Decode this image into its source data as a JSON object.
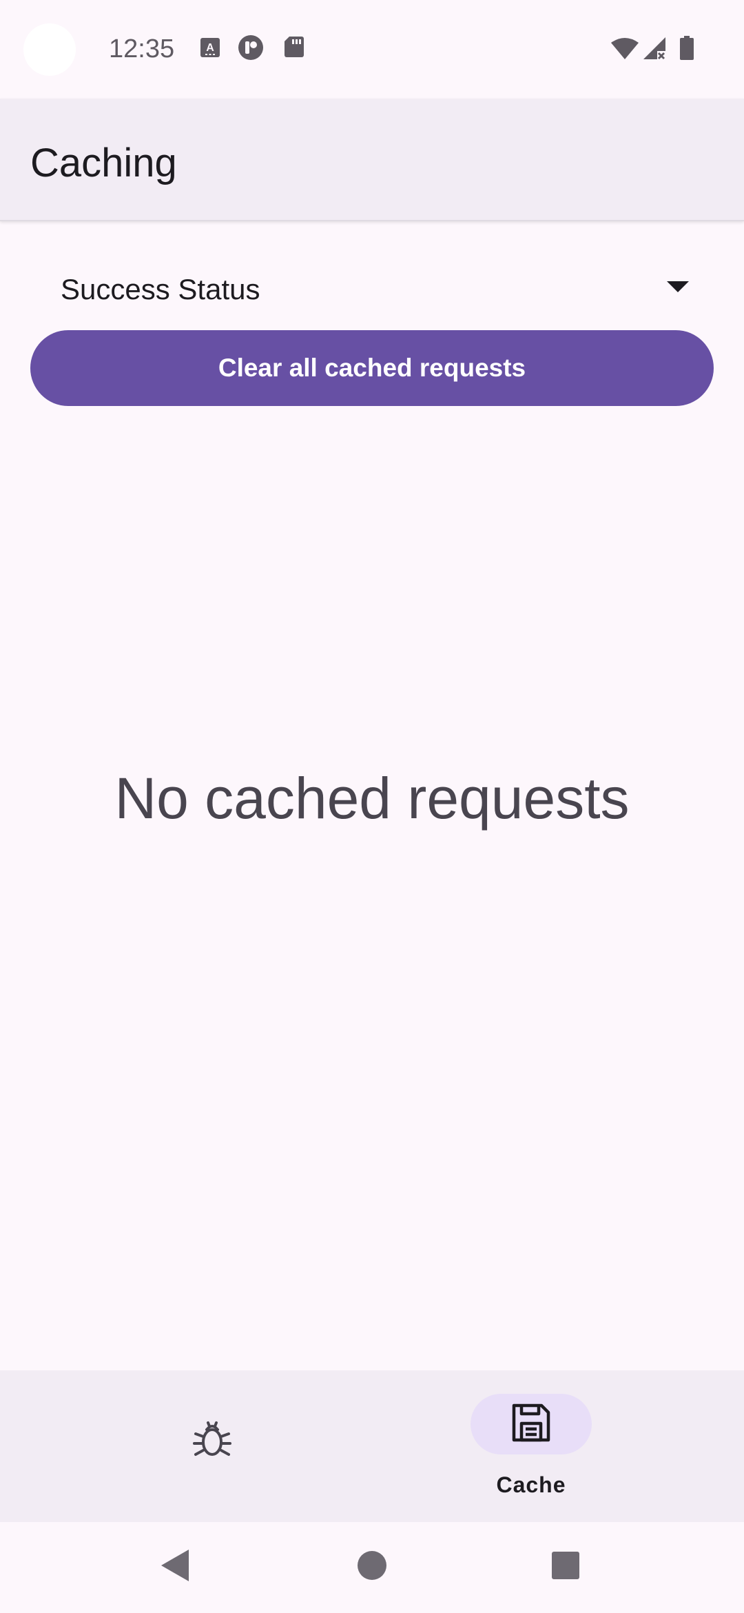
{
  "status_bar": {
    "time": "12:35",
    "icons": [
      "keyboard-a-icon",
      "app-notification-icon",
      "sd-card-icon",
      "wifi-icon",
      "signal-no-data-icon",
      "battery-icon"
    ]
  },
  "app_bar": {
    "title": "Caching"
  },
  "filter": {
    "selected": "Success Status",
    "icon": "dropdown-arrow-icon"
  },
  "actions": {
    "clear_label": "Clear all cached requests"
  },
  "empty_state": {
    "message": "No cached requests"
  },
  "bottom_nav": {
    "items": [
      {
        "icon": "bug-icon",
        "label": "",
        "selected": false
      },
      {
        "icon": "save-icon",
        "label": "Cache",
        "selected": true
      }
    ]
  },
  "system_nav": {
    "buttons": [
      "back-icon",
      "home-icon",
      "recents-icon"
    ]
  },
  "colors": {
    "primary": "#6750a4",
    "background": "#fdf7fc",
    "surface_container": "#f2ecf4",
    "selected_indicator": "#e8def8",
    "on_surface": "#1d1b20"
  }
}
